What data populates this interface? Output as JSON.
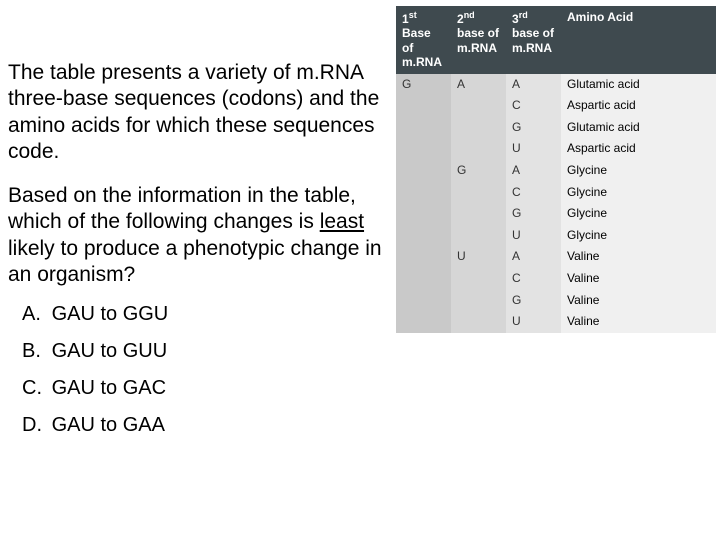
{
  "paragraph1_parts": {
    "full": "The table presents a variety of m.RNA three-base sequences (codons) and the amino acids for which these sequences code."
  },
  "paragraph2_parts": {
    "pre": "Based on the information in the table, which of the following changes is ",
    "least": "least",
    "post": " likely to produce a phenotypic change in an organism?"
  },
  "options": [
    {
      "letter": "A.",
      "text": "GAU to GGU"
    },
    {
      "letter": "B.",
      "text": "GAU to GUU"
    },
    {
      "letter": "C.",
      "text": "GAU to GAC"
    },
    {
      "letter": "D.",
      "text": "GAU to GAA"
    }
  ],
  "table": {
    "headers": {
      "c1a": "1",
      "c1b": " Base of m.RNA",
      "c2a": "2",
      "c2b": " base of m.RNA",
      "c3a": "3",
      "c3b": " base of m.RNA",
      "c4": "Amino Acid"
    },
    "sup": {
      "st": "st",
      "nd": "nd",
      "rd": "rd"
    },
    "rows": [
      {
        "b1": "G",
        "b2": "A",
        "b3": "A",
        "aa": "Glutamic acid"
      },
      {
        "b1": "",
        "b2": "",
        "b3": "C",
        "aa": "Aspartic acid"
      },
      {
        "b1": "",
        "b2": "",
        "b3": "G",
        "aa": "Glutamic acid"
      },
      {
        "b1": "",
        "b2": "",
        "b3": "U",
        "aa": "Aspartic acid"
      },
      {
        "b1": "",
        "b2": "G",
        "b3": "A",
        "aa": "Glycine"
      },
      {
        "b1": "",
        "b2": "",
        "b3": "C",
        "aa": "Glycine"
      },
      {
        "b1": "",
        "b2": "",
        "b3": "G",
        "aa": "Glycine"
      },
      {
        "b1": "",
        "b2": "",
        "b3": "U",
        "aa": "Glycine"
      },
      {
        "b1": "",
        "b2": "U",
        "b3": "A",
        "aa": "Valine"
      },
      {
        "b1": "",
        "b2": "",
        "b3": "C",
        "aa": "Valine"
      },
      {
        "b1": "",
        "b2": "",
        "b3": "G",
        "aa": "Valine"
      },
      {
        "b1": "",
        "b2": "",
        "b3": "U",
        "aa": "Valine"
      }
    ]
  }
}
